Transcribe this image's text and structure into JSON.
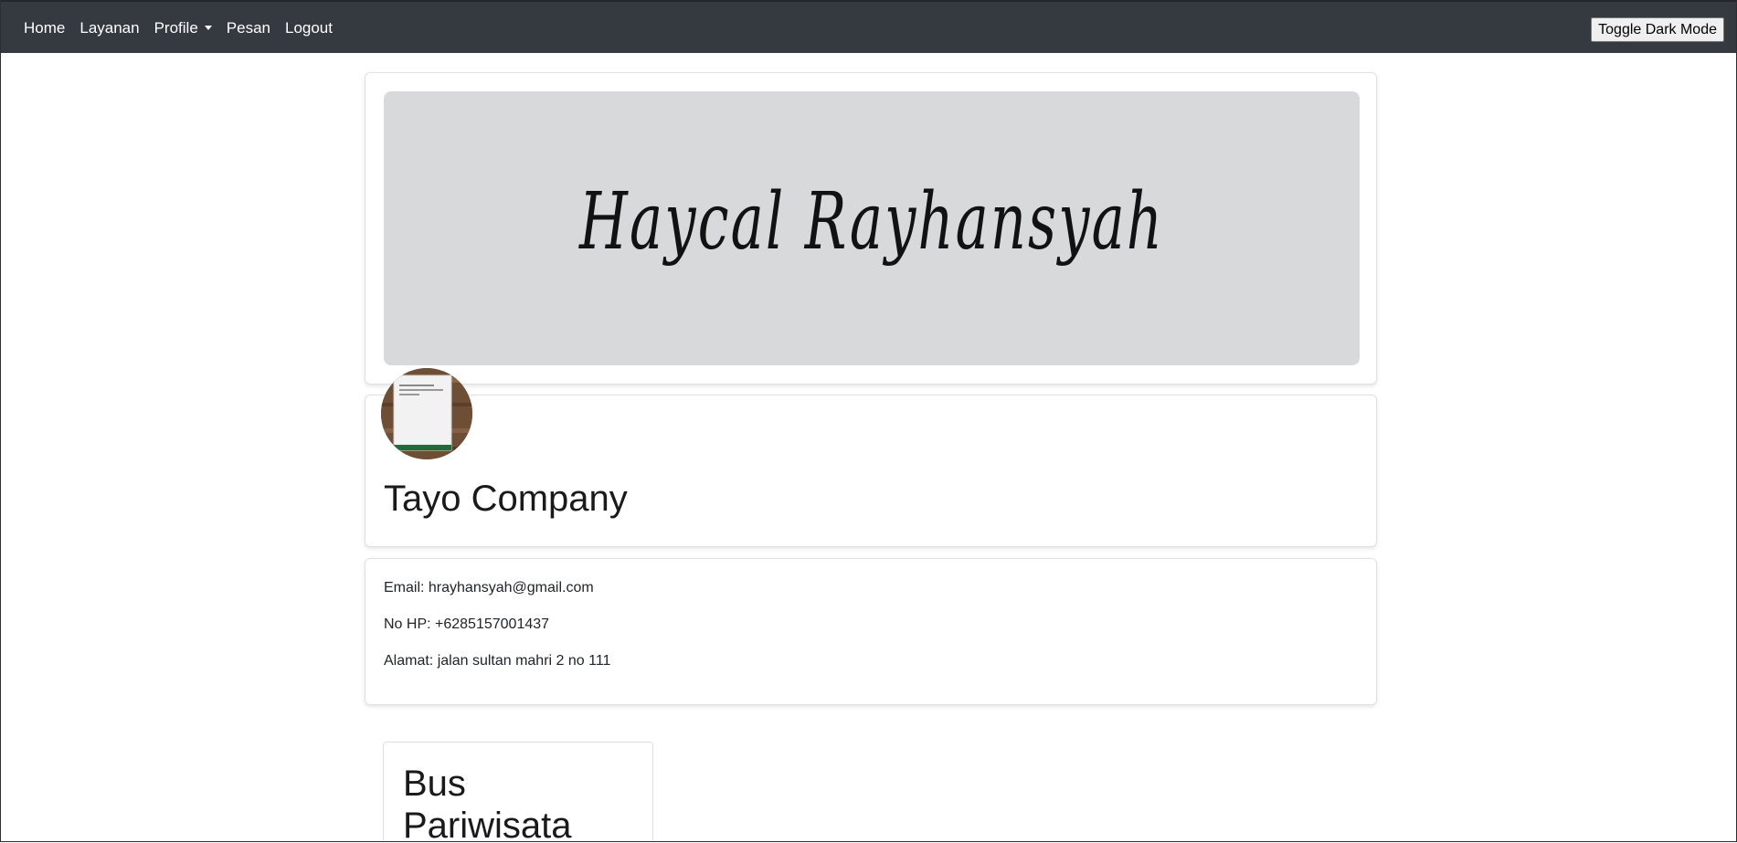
{
  "nav": {
    "links": [
      "Home",
      "Layanan",
      "Profile",
      "Pesan",
      "Logout"
    ],
    "toggle_label": "Toggle Dark Mode"
  },
  "banner": {
    "signature": "Haycal Rayhansyah"
  },
  "profile": {
    "company_name": "Tayo Company"
  },
  "contact": {
    "email": "Email: hrayhansyah@gmail.com",
    "phone": "No HP: +6285157001437",
    "address": "Alamat: jalan sultan mahri 2 no 111"
  },
  "services": [
    {
      "title": "Bus Pariwisata"
    }
  ],
  "colors": {
    "navbar_bg": "#343a40",
    "banner_bg": "#d8d9db",
    "text": "#212529"
  }
}
